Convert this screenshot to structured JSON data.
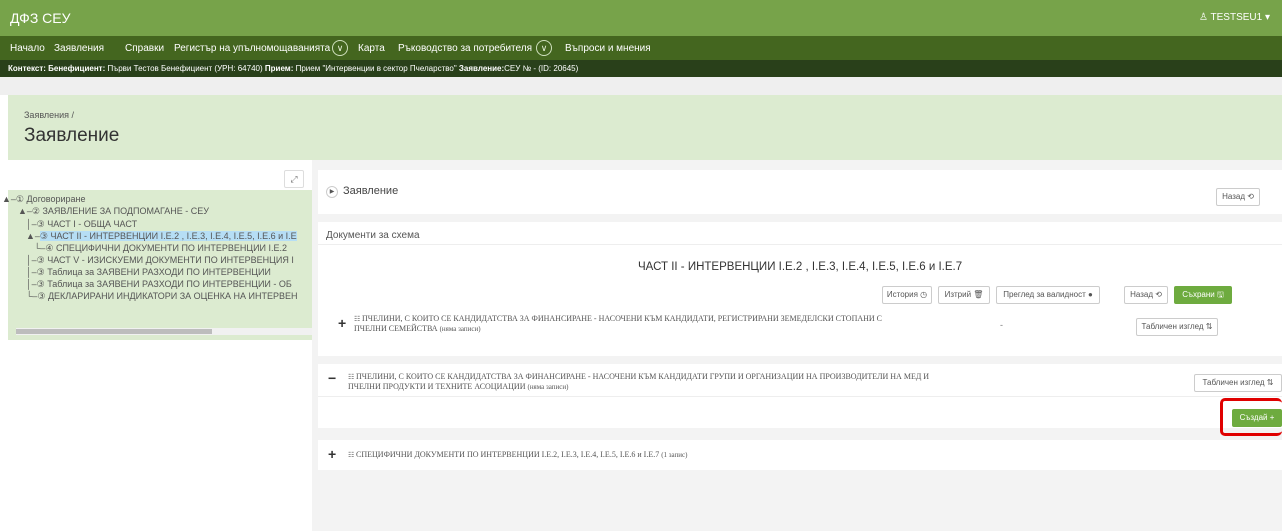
{
  "topbar": {
    "brand": "ДФЗ СЕУ",
    "user_icon": "user-icon",
    "user": "TESTSEU1 ▾"
  },
  "nav": {
    "home": "Начало",
    "applications": "Заявления",
    "reports": "Справки",
    "registry": "Регистър на упълномощаванията",
    "map": "Карта",
    "manual": "Ръководство за потребителя",
    "questions": "Въпроси и мнения"
  },
  "context": {
    "context_label": "Контекст:",
    "beneficiary_label": "Бенефициент:",
    "beneficiary": "Първи Тестов Бенефициент (УРН: 64740)",
    "intake_label": "Прием:",
    "intake": "Прием \"Интервенции в сектор Пчеларство\"",
    "application_label": "Заявление:",
    "application": "СЕУ № - (ID: 20645)"
  },
  "page": {
    "breadcrumb": "Заявления /",
    "title": "Заявление"
  },
  "tree": {
    "nodes": [
      "① Договориране",
      "② ЗАЯВЛЕНИЕ ЗА ПОДПОМАГАНЕ - СЕУ",
      "③ ЧАСТ I - ОБЩА ЧАСТ",
      "③ ЧАСТ II - ИНТЕРВЕНЦИИ I.Е.2 , I.Е.3, I.Е.4, I.Е.5, I.Е.6 и I.Е",
      "④ СПЕЦИФИЧНИ ДОКУМЕНТИ ПО ИНТЕРВЕНЦИИ I.Е.2",
      "③ ЧАСТ V - ИЗИСКУЕМИ ДОКУМЕНТИ ПО ИНТЕРВЕНЦИЯ I",
      "③ Таблица за ЗАЯВЕНИ РАЗХОДИ ПО ИНТЕРВЕНЦИИ",
      "③ Таблица за ЗАЯВЕНИ РАЗХОДИ ПО ИНТЕРВЕНЦИИ - ОБ",
      "③ ДЕКЛАРИРАНИ ИНДИКАТОРИ ЗА ОЦЕНКА НА ИНТЕРВЕН"
    ]
  },
  "panel_app": {
    "title": "Заявление",
    "back": "Назад ⟲"
  },
  "docs": {
    "title": "Документи за схема",
    "section_title": "ЧАСТ II - ИНТЕРВЕНЦИИ I.Е.2 , I.Е.3, I.Е.4, I.Е.5, I.Е.6 и I.Е.7",
    "history": "История ◷",
    "delete": "Изтрий 🗑",
    "validity": "Преглед за валидност ●",
    "back": "Назад ⟲",
    "save": "Съхрани 🖫"
  },
  "sections": [
    {
      "icon": "+",
      "text_line1": "ПЧЕЛИНИ, С КОИТО СЕ КАНДИДАТСТВА ЗА ФИНАНСИРАНЕ - НАСОЧЕНИ КЪМ КАНДИДАТИ, РЕГИСТРИРАНИ ЗЕМЕДЕЛСКИ СТОПАНИ С",
      "text_line2": "ПЧЕЛНИ СЕМЕЙСТВА",
      "note": "(няма записи)",
      "dash": "-",
      "table_view": "Табличен изглед ⇅"
    },
    {
      "icon": "−",
      "text_line1": "ПЧЕЛИНИ, С КОИТО СЕ КАНДИДАТСТВА ЗА ФИНАНСИРАНЕ - НАСОЧЕНИ КЪМ КАНДИДАТИ ГРУПИ И ОРГАНИЗАЦИИ НА ПРОИЗВОДИТЕЛИ НА МЕД И",
      "text_line2": "ПЧЕЛНИ ПРОДУКТИ И ТЕХНИТЕ АСОЦИАЦИИ",
      "note": "(няма записи)",
      "table_view": "Табличен изглед ⇅",
      "create": "Създай +"
    },
    {
      "icon": "+",
      "text_line1": "СПЕЦИФИЧНИ ДОКУМЕНТИ ПО ИНТЕРВЕНЦИИ I.Е.2, I.Е.3, I.Е.4, I.Е.5, I.Е.6 и I.Е.7",
      "note": "(1 запис)"
    }
  ],
  "colors": {
    "topbar": "#77a34a",
    "navbar": "#44661f",
    "contextbar": "#29401a",
    "accent": "#6eab3f",
    "highlight": "#e00000"
  }
}
